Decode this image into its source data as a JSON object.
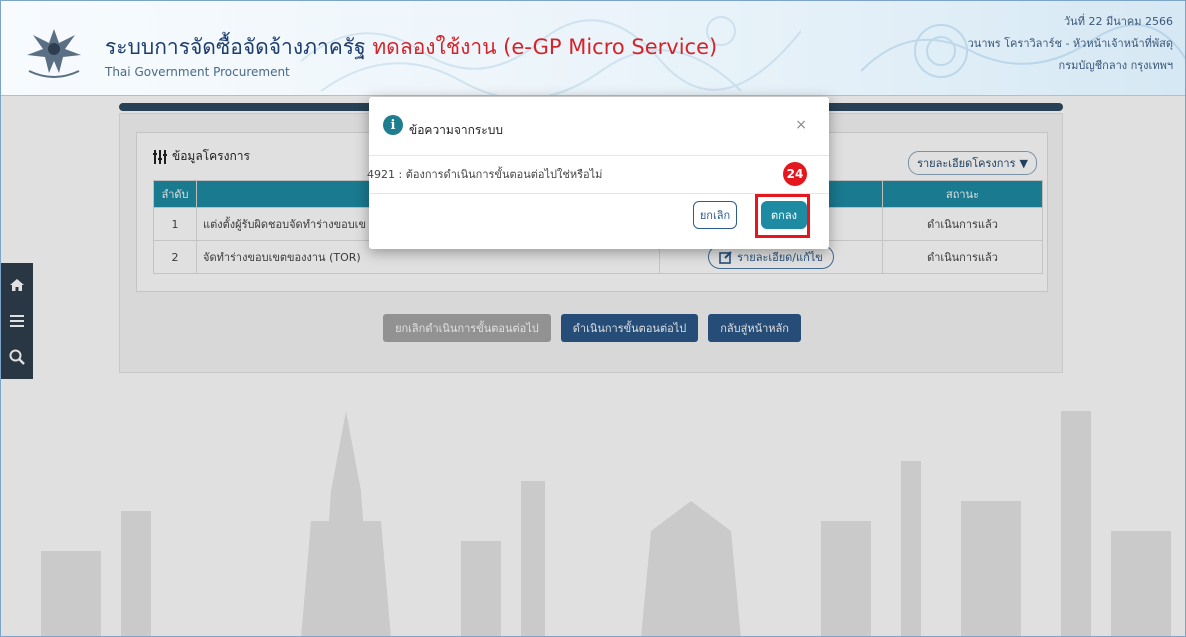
{
  "header": {
    "title_main": "ระบบการจัดซื้อจัดจ้างภาครัฐ",
    "title_trial": "ทดลองใช้งาน (e-GP Micro Service)",
    "subtitle": "Thai Government Procurement",
    "date": "วันที่ 22 มีนาคม 2566",
    "user": "วนาพร โคราวิลาร์ช - หัวหน้าเจ้าหน้าที่พัสดุ",
    "department": "กรมบัญชีกลาง กรุงเทพฯ"
  },
  "rail": {
    "icons": [
      "home-icon",
      "menu-icon",
      "search-icon"
    ]
  },
  "project": {
    "title": "ข้อมูลโครงการ",
    "detail_dropdown": "รายละเอียดโครงการ",
    "columns": [
      "ลำดับ",
      "",
      "",
      "สถานะ"
    ],
    "rows": [
      {
        "no": "1",
        "name": "แต่งตั้งผู้รับผิดชอบจัดทำร่างขอบเข",
        "status": "ดำเนินการแล้ว"
      },
      {
        "no": "2",
        "name": "จัดทำร่างขอบเขตของงาน (TOR)",
        "edit": "รายละเอียด/แก้ไข",
        "status": "ดำเนินการแล้ว"
      }
    ]
  },
  "actions": {
    "cancel_step": "ยกเลิกดำเนินการขั้นตอนต่อไป",
    "next_step": "ดำเนินการขั้นตอนต่อไป",
    "back_main": "กลับสู่หน้าหลัก"
  },
  "dialog": {
    "title": "ข้อความจากระบบ",
    "close": "×",
    "message": "4921 : ต้องการดำเนินการขั้นตอนต่อไปใช่หรือไม่",
    "cancel_label": "ยกเลิก",
    "ok_label": "ตกลง"
  },
  "annotation": {
    "step": "24"
  },
  "colors": {
    "accent": "#1e8ba3",
    "navy": "#2b5889",
    "highlight": "#e3171d"
  }
}
